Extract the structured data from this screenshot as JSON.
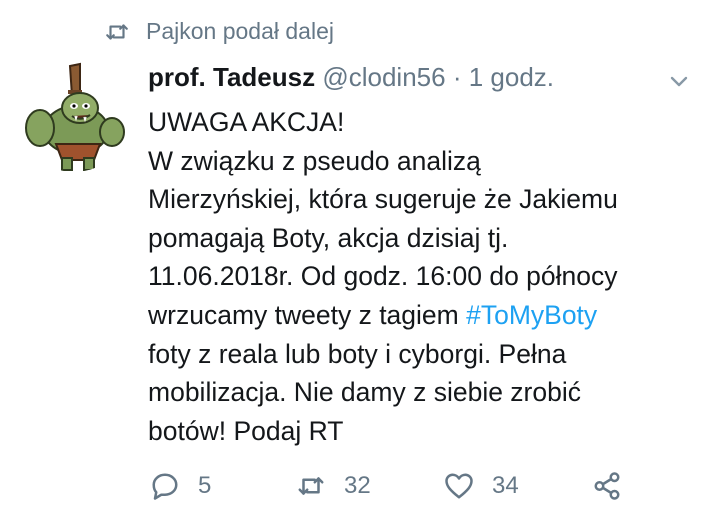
{
  "retweet": {
    "icon": "retweet-icon",
    "text": "Pajkon podał dalej"
  },
  "tweet": {
    "author_name": "prof. Tadeusz",
    "handle": "@clodin56",
    "separator": "·",
    "time": "1 godz.",
    "lines": {
      "l1": "UWAGA AKCJA!",
      "l2": "W związku z pseudo analizą",
      "l3": "Mierzyńskiej, która sugeruje że Jakiemu",
      "l4": "pomagają Boty, akcja dzisiaj tj.",
      "l5": "11.06.2018r. Od godz. 16:00 do północy",
      "l6_prefix": "wrzucamy tweety z tagiem ",
      "l6_hashtag": "#ToMyBoty",
      "l7": "foty z reala lub boty i cyborgi. Pełna",
      "l8": "mobilizacja. Nie damy z siebie zrobić",
      "l9": "botów! Podaj RT"
    },
    "hashtag_color": "#1da1f2"
  },
  "actions": {
    "reply_count": "5",
    "retweet_count": "32",
    "like_count": "34",
    "icons": [
      "reply-icon",
      "retweet-icon",
      "heart-icon",
      "share-icon"
    ]
  },
  "colors": {
    "muted": "#657786",
    "text": "#14171a",
    "link": "#1da1f2"
  }
}
